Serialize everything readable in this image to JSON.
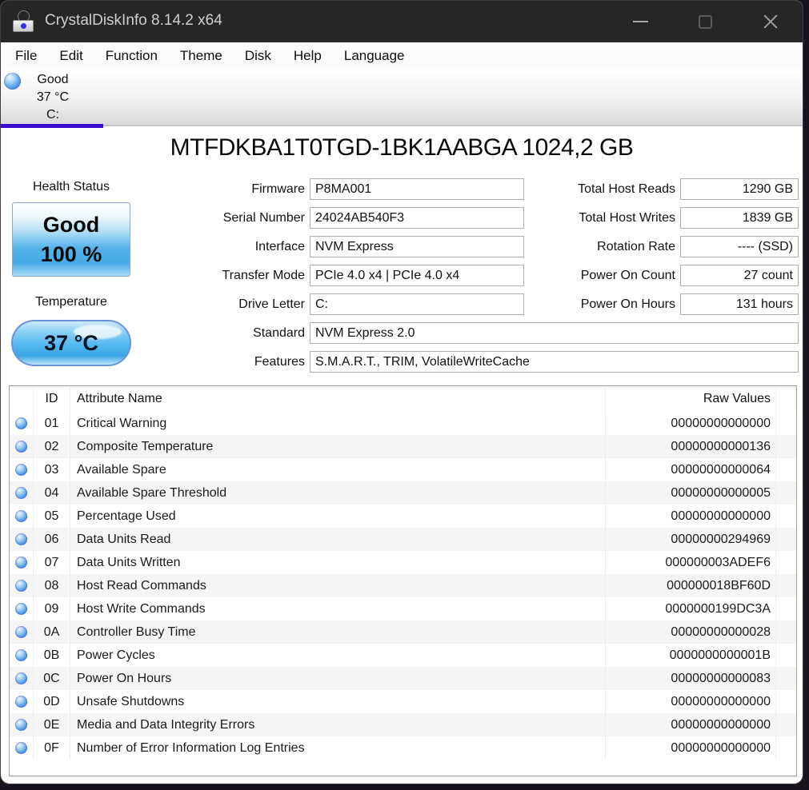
{
  "window": {
    "title": "CrystalDiskInfo 8.14.2 x64"
  },
  "menu": {
    "items": [
      "File",
      "Edit",
      "Function",
      "Theme",
      "Disk",
      "Help",
      "Language"
    ]
  },
  "drive_tab": {
    "status": "Good",
    "temperature": "37 °C",
    "letter": "C:"
  },
  "drive": {
    "model": "MTFDKBA1T0TGD-1BK1AABGA 1024,2 GB",
    "health": {
      "label": "Health Status",
      "status": "Good",
      "percent": "100 %"
    },
    "temperature": {
      "label": "Temperature",
      "value": "37 °C"
    },
    "info_left": [
      {
        "label": "Firmware",
        "value": "P8MA001"
      },
      {
        "label": "Serial Number",
        "value": "24024AB540F3"
      },
      {
        "label": "Interface",
        "value": "NVM Express"
      },
      {
        "label": "Transfer Mode",
        "value": "PCIe 4.0 x4 | PCIe 4.0 x4"
      },
      {
        "label": "Drive Letter",
        "value": "C:"
      },
      {
        "label": "Standard",
        "value": "NVM Express 2.0"
      },
      {
        "label": "Features",
        "value": "S.M.A.R.T., TRIM, VolatileWriteCache"
      }
    ],
    "info_right": [
      {
        "label": "Total Host Reads",
        "value": "1290 GB"
      },
      {
        "label": "Total Host Writes",
        "value": "1839 GB"
      },
      {
        "label": "Rotation Rate",
        "value": "---- (SSD)"
      },
      {
        "label": "Power On Count",
        "value": "27 count"
      },
      {
        "label": "Power On Hours",
        "value": "131 hours"
      }
    ]
  },
  "smart": {
    "headers": {
      "id": "ID",
      "name": "Attribute Name",
      "raw": "Raw Values"
    },
    "rows": [
      {
        "id": "01",
        "name": "Critical Warning",
        "raw": "00000000000000"
      },
      {
        "id": "02",
        "name": "Composite Temperature",
        "raw": "00000000000136"
      },
      {
        "id": "03",
        "name": "Available Spare",
        "raw": "00000000000064"
      },
      {
        "id": "04",
        "name": "Available Spare Threshold",
        "raw": "00000000000005"
      },
      {
        "id": "05",
        "name": "Percentage Used",
        "raw": "00000000000000"
      },
      {
        "id": "06",
        "name": "Data Units Read",
        "raw": "00000000294969"
      },
      {
        "id": "07",
        "name": "Data Units Written",
        "raw": "000000003ADEF6"
      },
      {
        "id": "08",
        "name": "Host Read Commands",
        "raw": "000000018BF60D"
      },
      {
        "id": "09",
        "name": "Host Write Commands",
        "raw": "0000000199DC3A"
      },
      {
        "id": "0A",
        "name": "Controller Busy Time",
        "raw": "00000000000028"
      },
      {
        "id": "0B",
        "name": "Power Cycles",
        "raw": "0000000000001B"
      },
      {
        "id": "0C",
        "name": "Power On Hours",
        "raw": "00000000000083"
      },
      {
        "id": "0D",
        "name": "Unsafe Shutdowns",
        "raw": "00000000000000"
      },
      {
        "id": "0E",
        "name": "Media and Data Integrity Errors",
        "raw": "00000000000000"
      },
      {
        "id": "0F",
        "name": "Number of Error Information Log Entries",
        "raw": "00000000000000"
      }
    ]
  },
  "colors": {
    "titlebar": "#262626",
    "accent_tab_underline": "#3a0ccd",
    "health_blue": "#55b2ea",
    "status_orb_blue": "#539fe6"
  }
}
